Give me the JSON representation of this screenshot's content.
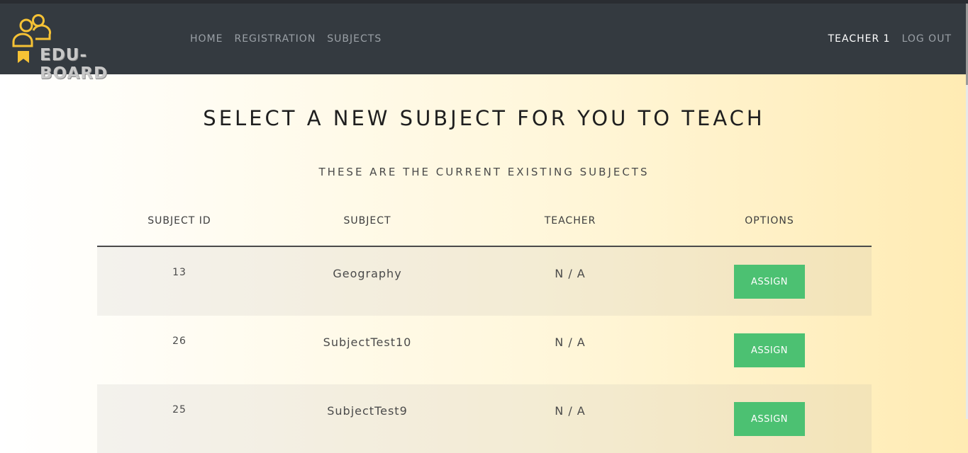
{
  "brand": {
    "name": "EDU-BOARD",
    "icon": "users-award-icon",
    "accent": "#f6c235"
  },
  "nav": {
    "links": [
      "HOME",
      "REGISTRATION",
      "SUBJECTS"
    ],
    "user": "TEACHER 1",
    "logout": "LOG OUT"
  },
  "page": {
    "title": "SELECT A NEW SUBJECT FOR YOU TO TEACH",
    "subtitle": "THESE ARE THE CURRENT EXISTING SUBJECTS"
  },
  "table": {
    "headers": [
      "SUBJECT ID",
      "SUBJECT",
      "TEACHER",
      "OPTIONS"
    ],
    "rows": [
      {
        "id": "13",
        "subject": "Geography",
        "teacher": "N / A",
        "action": "ASSIGN"
      },
      {
        "id": "26",
        "subject": "SubjectTest10",
        "teacher": "N / A",
        "action": "ASSIGN"
      },
      {
        "id": "25",
        "subject": "SubjectTest9",
        "teacher": "N / A",
        "action": "ASSIGN"
      }
    ]
  },
  "colors": {
    "navbar": "#343a40",
    "button": "#4cc172"
  }
}
